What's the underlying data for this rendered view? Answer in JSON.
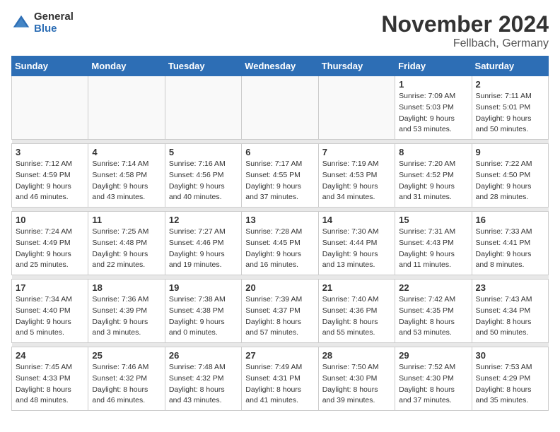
{
  "header": {
    "logo_general": "General",
    "logo_blue": "Blue",
    "month_title": "November 2024",
    "location": "Fellbach, Germany"
  },
  "weekdays": [
    "Sunday",
    "Monday",
    "Tuesday",
    "Wednesday",
    "Thursday",
    "Friday",
    "Saturday"
  ],
  "weeks": [
    [
      {
        "day": "",
        "info": ""
      },
      {
        "day": "",
        "info": ""
      },
      {
        "day": "",
        "info": ""
      },
      {
        "day": "",
        "info": ""
      },
      {
        "day": "",
        "info": ""
      },
      {
        "day": "1",
        "info": "Sunrise: 7:09 AM\nSunset: 5:03 PM\nDaylight: 9 hours and 53 minutes."
      },
      {
        "day": "2",
        "info": "Sunrise: 7:11 AM\nSunset: 5:01 PM\nDaylight: 9 hours and 50 minutes."
      }
    ],
    [
      {
        "day": "3",
        "info": "Sunrise: 7:12 AM\nSunset: 4:59 PM\nDaylight: 9 hours and 46 minutes."
      },
      {
        "day": "4",
        "info": "Sunrise: 7:14 AM\nSunset: 4:58 PM\nDaylight: 9 hours and 43 minutes."
      },
      {
        "day": "5",
        "info": "Sunrise: 7:16 AM\nSunset: 4:56 PM\nDaylight: 9 hours and 40 minutes."
      },
      {
        "day": "6",
        "info": "Sunrise: 7:17 AM\nSunset: 4:55 PM\nDaylight: 9 hours and 37 minutes."
      },
      {
        "day": "7",
        "info": "Sunrise: 7:19 AM\nSunset: 4:53 PM\nDaylight: 9 hours and 34 minutes."
      },
      {
        "day": "8",
        "info": "Sunrise: 7:20 AM\nSunset: 4:52 PM\nDaylight: 9 hours and 31 minutes."
      },
      {
        "day": "9",
        "info": "Sunrise: 7:22 AM\nSunset: 4:50 PM\nDaylight: 9 hours and 28 minutes."
      }
    ],
    [
      {
        "day": "10",
        "info": "Sunrise: 7:24 AM\nSunset: 4:49 PM\nDaylight: 9 hours and 25 minutes."
      },
      {
        "day": "11",
        "info": "Sunrise: 7:25 AM\nSunset: 4:48 PM\nDaylight: 9 hours and 22 minutes."
      },
      {
        "day": "12",
        "info": "Sunrise: 7:27 AM\nSunset: 4:46 PM\nDaylight: 9 hours and 19 minutes."
      },
      {
        "day": "13",
        "info": "Sunrise: 7:28 AM\nSunset: 4:45 PM\nDaylight: 9 hours and 16 minutes."
      },
      {
        "day": "14",
        "info": "Sunrise: 7:30 AM\nSunset: 4:44 PM\nDaylight: 9 hours and 13 minutes."
      },
      {
        "day": "15",
        "info": "Sunrise: 7:31 AM\nSunset: 4:43 PM\nDaylight: 9 hours and 11 minutes."
      },
      {
        "day": "16",
        "info": "Sunrise: 7:33 AM\nSunset: 4:41 PM\nDaylight: 9 hours and 8 minutes."
      }
    ],
    [
      {
        "day": "17",
        "info": "Sunrise: 7:34 AM\nSunset: 4:40 PM\nDaylight: 9 hours and 5 minutes."
      },
      {
        "day": "18",
        "info": "Sunrise: 7:36 AM\nSunset: 4:39 PM\nDaylight: 9 hours and 3 minutes."
      },
      {
        "day": "19",
        "info": "Sunrise: 7:38 AM\nSunset: 4:38 PM\nDaylight: 9 hours and 0 minutes."
      },
      {
        "day": "20",
        "info": "Sunrise: 7:39 AM\nSunset: 4:37 PM\nDaylight: 8 hours and 57 minutes."
      },
      {
        "day": "21",
        "info": "Sunrise: 7:40 AM\nSunset: 4:36 PM\nDaylight: 8 hours and 55 minutes."
      },
      {
        "day": "22",
        "info": "Sunrise: 7:42 AM\nSunset: 4:35 PM\nDaylight: 8 hours and 53 minutes."
      },
      {
        "day": "23",
        "info": "Sunrise: 7:43 AM\nSunset: 4:34 PM\nDaylight: 8 hours and 50 minutes."
      }
    ],
    [
      {
        "day": "24",
        "info": "Sunrise: 7:45 AM\nSunset: 4:33 PM\nDaylight: 8 hours and 48 minutes."
      },
      {
        "day": "25",
        "info": "Sunrise: 7:46 AM\nSunset: 4:32 PM\nDaylight: 8 hours and 46 minutes."
      },
      {
        "day": "26",
        "info": "Sunrise: 7:48 AM\nSunset: 4:32 PM\nDaylight: 8 hours and 43 minutes."
      },
      {
        "day": "27",
        "info": "Sunrise: 7:49 AM\nSunset: 4:31 PM\nDaylight: 8 hours and 41 minutes."
      },
      {
        "day": "28",
        "info": "Sunrise: 7:50 AM\nSunset: 4:30 PM\nDaylight: 8 hours and 39 minutes."
      },
      {
        "day": "29",
        "info": "Sunrise: 7:52 AM\nSunset: 4:30 PM\nDaylight: 8 hours and 37 minutes."
      },
      {
        "day": "30",
        "info": "Sunrise: 7:53 AM\nSunset: 4:29 PM\nDaylight: 8 hours and 35 minutes."
      }
    ]
  ]
}
